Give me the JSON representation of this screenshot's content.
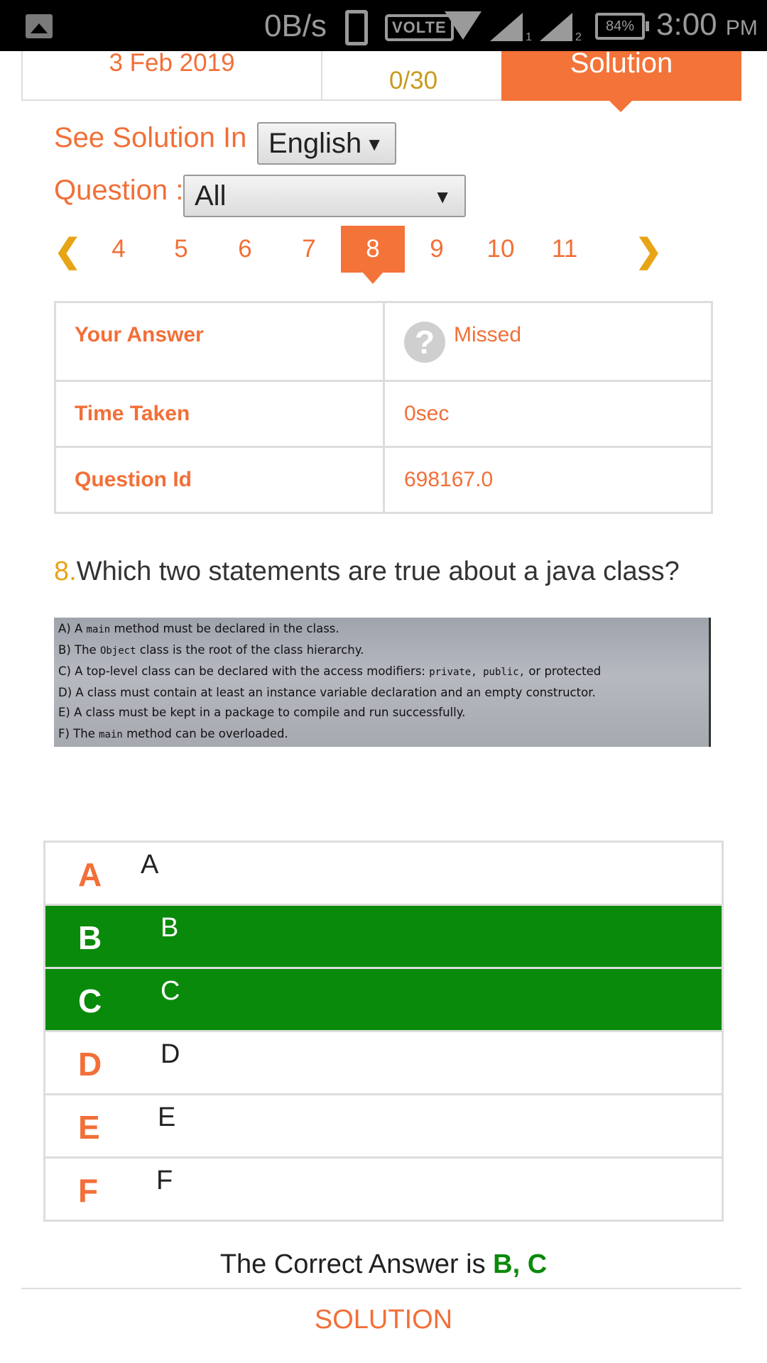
{
  "status_bar": {
    "net_speed": "0B/s",
    "volte": "VOLTE",
    "sim1": "1",
    "sim2": "2",
    "battery": "84%",
    "time": "3:00",
    "ampm": "PM"
  },
  "header": {
    "date": "3 Feb 2019",
    "score": "0/30",
    "solution_tab": "Solution"
  },
  "filters": {
    "see_solution_label": "See Solution In :",
    "language": "English",
    "question_label": "Question :",
    "question_filter": "All"
  },
  "pager": {
    "pages": [
      "4",
      "5",
      "6",
      "7",
      "8",
      "9",
      "10",
      "11"
    ],
    "active": "8"
  },
  "info_table": {
    "your_answer_label": "Your Answer",
    "your_answer_value": "Missed",
    "time_taken_label": "Time Taken",
    "time_taken_value": "0sec",
    "question_id_label": "Question Id",
    "question_id_value": "698167.0"
  },
  "question": {
    "number": "8.",
    "text": "Which two statements are true about a java class?"
  },
  "question_image": {
    "lines": [
      {
        "pre": "A) A ",
        "mono": "main",
        "post": " method must be declared in the class."
      },
      {
        "pre": "B) The ",
        "mono": "Object",
        "post": " class is the root of the class hierarchy."
      },
      {
        "pre": "C) A top-level class can be declared with the access modifiers: ",
        "mono": "private, public,",
        "post": " or protected"
      },
      {
        "pre": "D) A class must contain at least an instance variable declaration and an empty constructor.",
        "mono": "",
        "post": ""
      },
      {
        "pre": "E) A class must be kept in a package to compile and run successfully.",
        "mono": "",
        "post": ""
      },
      {
        "pre": "F) The ",
        "mono": "main",
        "post": " method can be overloaded."
      }
    ]
  },
  "options": [
    {
      "letter": "A",
      "text": "A",
      "correct": false
    },
    {
      "letter": "B",
      "text": "B",
      "correct": true
    },
    {
      "letter": "C",
      "text": "C",
      "correct": true
    },
    {
      "letter": "D",
      "text": "D",
      "correct": false
    },
    {
      "letter": "E",
      "text": "E",
      "correct": false
    },
    {
      "letter": "F",
      "text": "F",
      "correct": false
    }
  ],
  "result": {
    "prefix": "The Correct Answer is ",
    "answer": "B, C"
  },
  "solution_button": "SOLUTION",
  "colors": {
    "accent": "#f47338",
    "correct": "#0a8a0a",
    "gold": "#e7a416"
  }
}
